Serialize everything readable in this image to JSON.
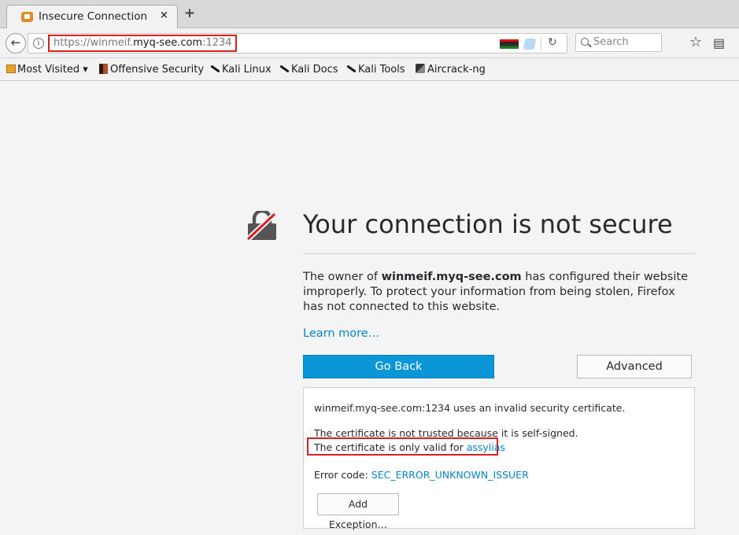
{
  "tab": {
    "title": "Insecure Connection",
    "close": "×",
    "new_tab": "+"
  },
  "nav": {
    "back": "←",
    "url_prefix": "https://winmeif.",
    "url_host": "myq-see.com",
    "url_port": ":1234",
    "reload": "↻",
    "search_placeholder": "Search",
    "star": "☆",
    "library": "▤"
  },
  "bookmarks": [
    {
      "label": "Most Visited ▾",
      "icon": "folder-icon"
    },
    {
      "label": "Offensive Security",
      "icon": "offsec-icon"
    },
    {
      "label": "Kali Linux",
      "icon": "kali-icon"
    },
    {
      "label": "Kali Docs",
      "icon": "kali-icon"
    },
    {
      "label": "Kali Tools",
      "icon": "kali-icon"
    },
    {
      "label": "Aircrack-ng",
      "icon": "aircrack-icon"
    }
  ],
  "error": {
    "headline": "Your connection is not secure",
    "desc_before": "The owner of ",
    "desc_host": "winmeif.myq-see.com",
    "desc_after": " has configured their website improperly. To protect your information from being stolen, Firefox has not connected to this website.",
    "learn_more": "Learn more…",
    "go_back": "Go Back",
    "advanced": "Advanced"
  },
  "advanced": {
    "line1": "winmeif.myq-see.com:1234 uses an invalid security certificate.",
    "line2": "The certificate is not trusted because it is self-signed.",
    "line3_prefix": "The certificate is only valid for ",
    "line3_link": "assylias",
    "error_prefix": "Error code: ",
    "error_code": "SEC_ERROR_UNKNOWN_ISSUER",
    "add_exception": "Add Exception…"
  },
  "colors": {
    "accent_blue": "#0a96d7",
    "link_blue": "#0a84c8",
    "highlight_red": "#d82020"
  }
}
